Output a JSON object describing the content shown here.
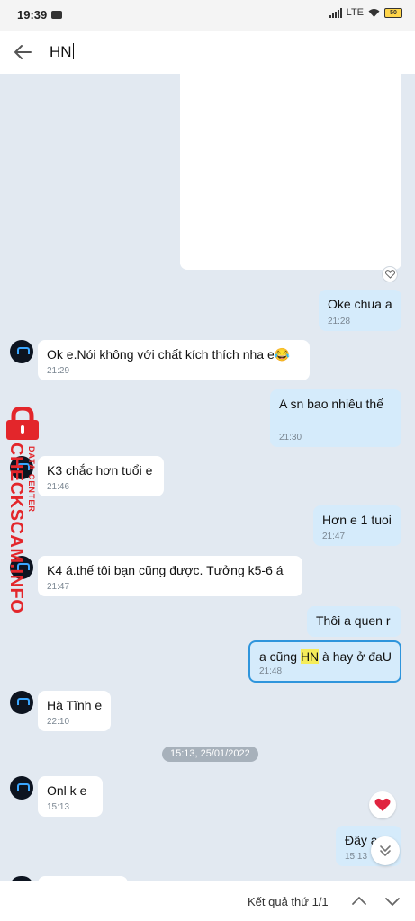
{
  "status_bar": {
    "time": "19:39",
    "network": "LTE",
    "battery": "50"
  },
  "search": {
    "query": "HN"
  },
  "messages": [
    {
      "text": "Oke chua a",
      "time": "21:28"
    },
    {
      "text": "Ok e.Nói không với chất kích thích nha e😂",
      "time": "21:29"
    },
    {
      "text": "A sn bao nhiêu thế",
      "time": "21:30"
    },
    {
      "text": "K3 chắc hơn tuổi e",
      "time": "21:46"
    },
    {
      "text": "Hơn e 1 tuoi",
      "time": "21:47"
    },
    {
      "text": "K4 á.thế tôi bạn cũng được. Tưởng k5-6 á",
      "time": "21:47"
    },
    {
      "text": "Thôi a quen r",
      "time": ""
    },
    {
      "text_before": "a cũng ",
      "highlight": "HN",
      "text_after": " à hay ở đaU",
      "time": "21:48"
    },
    {
      "text": "Hà Tĩnh e",
      "time": "22:10"
    },
    {
      "text": "Onl k e",
      "time": "15:13"
    },
    {
      "text": "Đây a",
      "time": "15:13"
    }
  ],
  "date_separator": "15:13, 25/01/2022",
  "watermark": {
    "brand": "CHECKSCAM.INFO",
    "subtitle": "DATA CENTER"
  },
  "bottom_bar": {
    "result_label": "Kết quả thứ 1/1"
  },
  "colors": {
    "outgoing": "#d5ebfb",
    "incoming": "#ffffff",
    "highlight": "#f5ec5a",
    "accent": "#2f95dc",
    "watermark": "#e3262b"
  },
  "icons": [
    "back-arrow-icon",
    "heart-icon",
    "chevron-down-double-icon",
    "chevron-up-icon",
    "chevron-down-icon",
    "lock-icon"
  ]
}
